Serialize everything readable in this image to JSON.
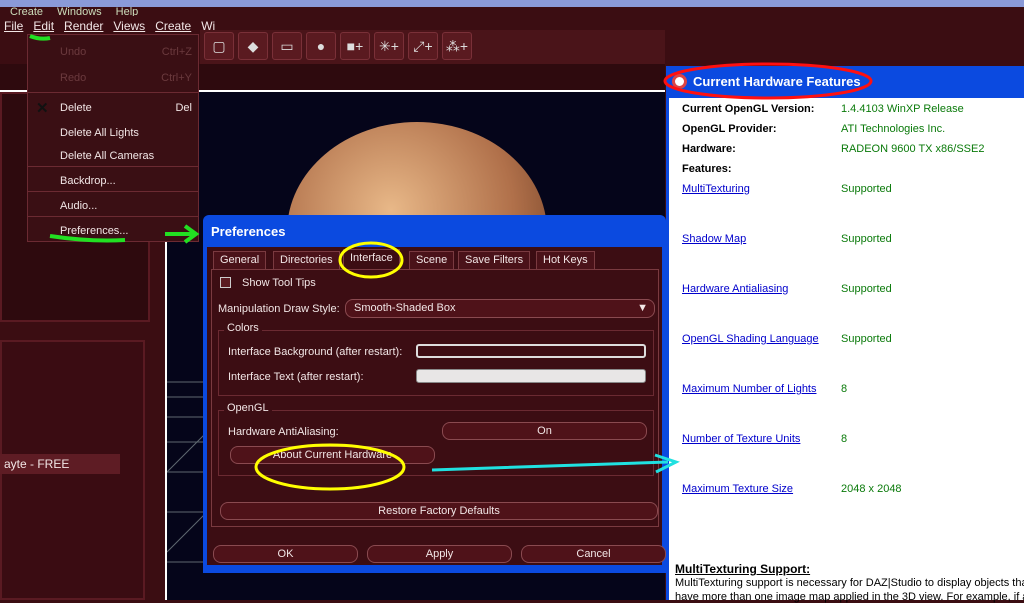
{
  "ghost_menu": [
    "Create",
    "Windows",
    "Help"
  ],
  "menubar": [
    "File",
    "Edit",
    "Render",
    "Views",
    "Create",
    "Wi"
  ],
  "toolbar_icons": [
    "box-icon",
    "eraser-icon",
    "frame-icon",
    "sphere-icon",
    "add-camera-icon",
    "add-light-icon",
    "add-spotlight-icon",
    "add-distant-light-icon"
  ],
  "edit_menu": {
    "undo": "Undo",
    "undo_sc": "Ctrl+Z",
    "redo": "Redo",
    "redo_sc": "Ctrl+Y",
    "delete": "Delete",
    "delete_sc": "Del",
    "delete_lights": "Delete All Lights",
    "delete_cameras": "Delete All Cameras",
    "backdrop": "Backdrop...",
    "audio": "Audio...",
    "preferences": "Preferences..."
  },
  "left_panel": {
    "selected_item": "ayte - FREE"
  },
  "preferences": {
    "title": "Preferences",
    "tabs": [
      "General",
      "Directories",
      "Interface",
      "Scene",
      "Save Filters",
      "Hot Keys"
    ],
    "active_tab": "Interface",
    "show_tool_tips": "Show Tool Tips",
    "draw_style_label": "Manipulation Draw Style:",
    "draw_style_value": "Smooth-Shaded Box",
    "colors_group": "Colors",
    "bg_label": "Interface Background (after restart):",
    "text_label": "Interface Text (after restart):",
    "opengl_group": "OpenGL",
    "aa_label": "Hardware AntiAliasing:",
    "aa_value": "On",
    "about_hw": "About Current Hardware",
    "restore": "Restore Factory Defaults",
    "ok": "OK",
    "apply": "Apply",
    "cancel": "Cancel"
  },
  "hardware": {
    "title": "Current Hardware Features",
    "opengl_version_label": "Current OpenGL Version:",
    "opengl_version": "1.4.4103 WinXP Release",
    "provider_label": "OpenGL Provider:",
    "provider": "ATI Technologies Inc.",
    "hardware_label": "Hardware:",
    "hardware": "RADEON 9600 TX x86/SSE2",
    "features_label": "Features:",
    "features": [
      {
        "name": "MultiTexturing",
        "value": "Supported"
      },
      {
        "name": "Shadow Map",
        "value": "Supported"
      },
      {
        "name": "Hardware Antialiasing",
        "value": "Supported"
      },
      {
        "name": "OpenGL Shading Language",
        "value": "Supported"
      },
      {
        "name": "Maximum Number of Lights",
        "value": "8"
      },
      {
        "name": "Number of Texture Units",
        "value": "8"
      },
      {
        "name": "Maximum Texture Size",
        "value": "2048 x 2048"
      }
    ],
    "support_heading": "MultiTexturing Support:",
    "support_line1": "MultiTexturing support is necessary for DAZ|Studio to display objects tha",
    "support_line2": "have more than one image map applied in the 3D view. For example, if a"
  },
  "colors": {
    "accent": "#0b4ae0",
    "annotation_green": "#22e022",
    "annotation_yellow": "#ffff00",
    "annotation_red": "#ff1010",
    "annotation_cyan": "#20e0e0"
  }
}
